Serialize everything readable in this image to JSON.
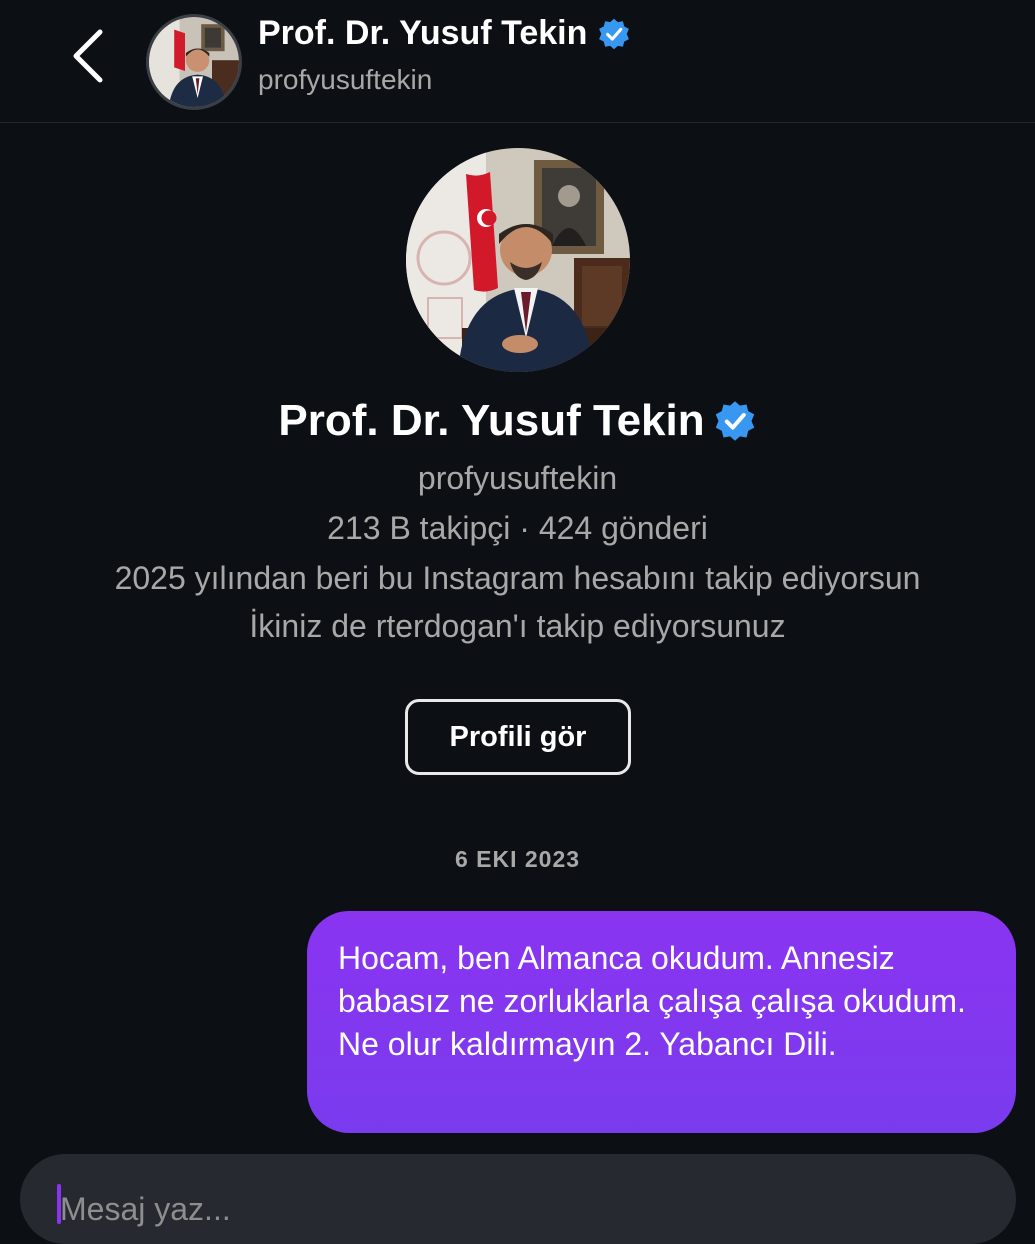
{
  "header": {
    "name": "Prof. Dr. Yusuf Tekin",
    "username": "profyusuftekin",
    "icons": {
      "back": "chevron-left-icon",
      "verified": "verified-badge-icon"
    }
  },
  "profile": {
    "name": "Prof. Dr. Yusuf Tekin",
    "username": "profyusuftekin",
    "stats": "213 B takipçi · 424 gönderi",
    "following_since": "2025 yılından beri bu Instagram hesabını takip ediyorsun",
    "mutual": "İkiniz de rterdogan'ı takip ediyorsunuz",
    "view_profile_label": "Profili gör"
  },
  "messages": {
    "date": "6 EKI 2023",
    "items": [
      {
        "sender": "me",
        "text": "Hocam, ben Almanca okudum. Annesiz babasız ne zorluklarla çalışa çalışa okudum. Ne olur kaldırmayın 2. Yabancı Dili."
      }
    ]
  },
  "composer": {
    "placeholder": "Mesaj yaz..."
  },
  "colors": {
    "background": "#0c1014",
    "bubble": "#7c3aed",
    "verified": "#3897f0",
    "secondary_text": "#a8a8a8"
  }
}
